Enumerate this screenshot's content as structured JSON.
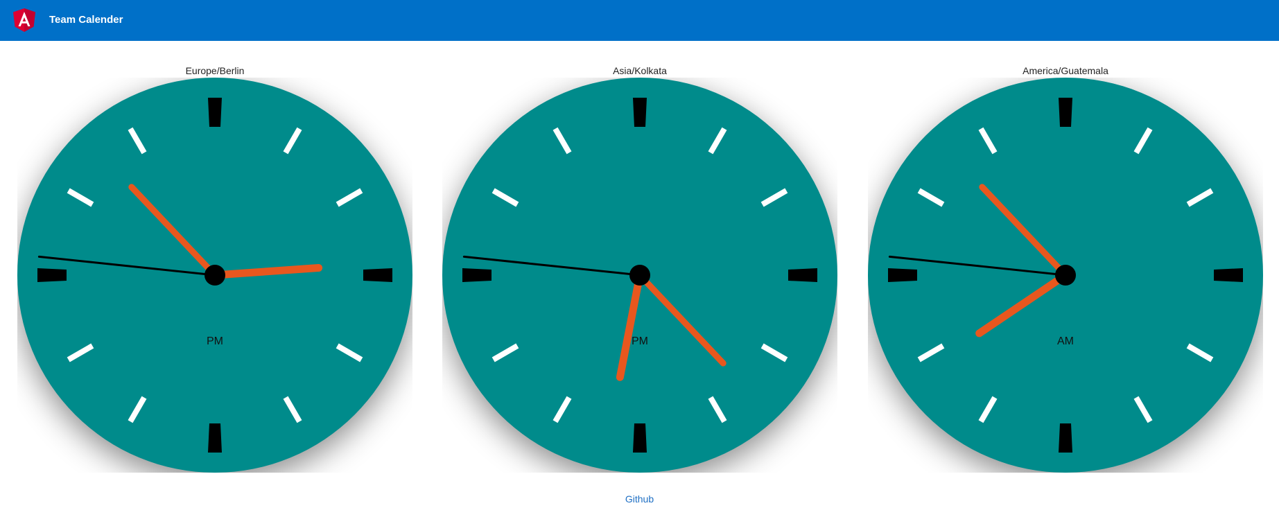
{
  "header": {
    "app_title": "Team Calender",
    "logo_icon": "angular-logo-icon",
    "bar_color": "#0070c8"
  },
  "clocks": [
    {
      "timezone": "Europe/Berlin",
      "period": "PM",
      "hour": 2,
      "minute": 52,
      "second": 46
    },
    {
      "timezone": "Asia/Kolkata",
      "period": "PM",
      "hour": 6,
      "minute": 22,
      "second": 46
    },
    {
      "timezone": "America/Guatemala",
      "period": "AM",
      "hour": 7,
      "minute": 52,
      "second": 46
    }
  ],
  "colors": {
    "face": "#008b8b",
    "hand_hour_minute": "#e8571e",
    "hand_second": "#000000",
    "tick_major": "#000000",
    "tick_minor": "#ffffff"
  },
  "footer": {
    "link_label": "Github"
  }
}
